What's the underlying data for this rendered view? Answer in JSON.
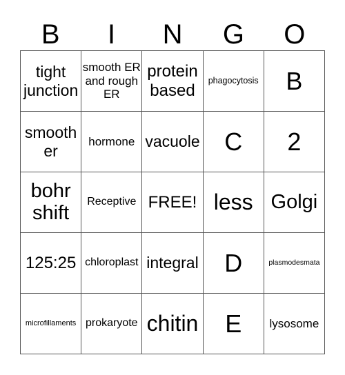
{
  "header": [
    "B",
    "I",
    "N",
    "G",
    "O"
  ],
  "cells": [
    [
      "tight junction",
      "smooth ER and rough ER",
      "protein based",
      "phagocytosis",
      "B"
    ],
    [
      "smooth er",
      "hormone",
      "vacuole",
      "C",
      "2"
    ],
    [
      "bohr shift",
      "Receptive",
      "FREE!",
      "less",
      "Golgi"
    ],
    [
      "125:25",
      "chloroplast",
      "integral",
      "D",
      "plasmodesmata"
    ],
    [
      "microfillaments",
      "prokaryote",
      "chitin",
      "E",
      "lysosome"
    ]
  ]
}
